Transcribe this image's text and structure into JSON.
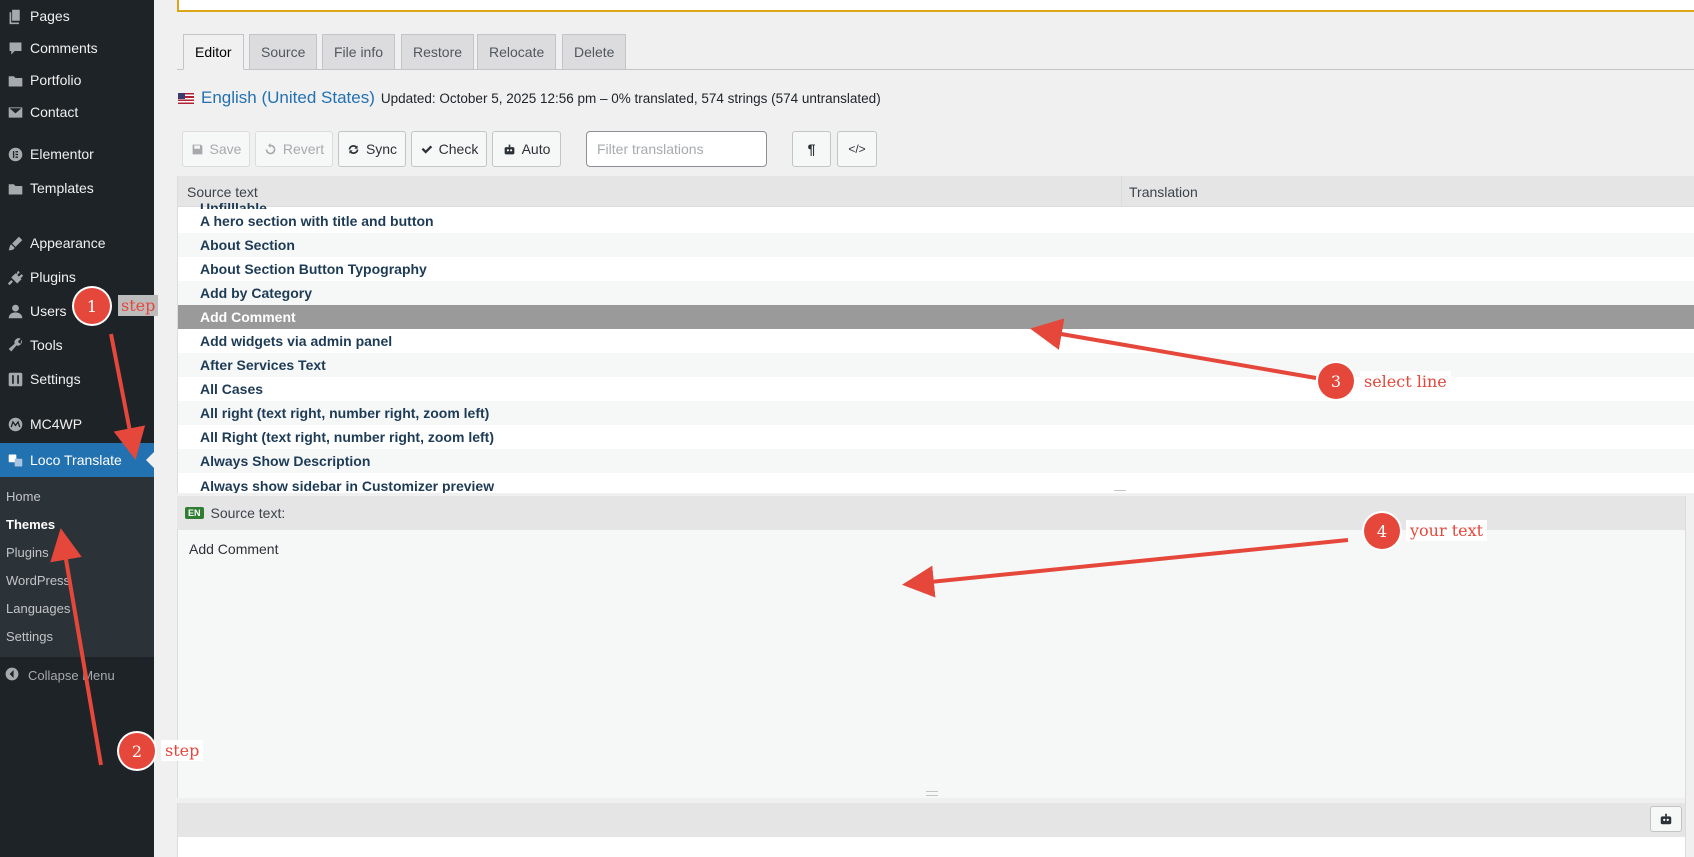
{
  "sidebar": {
    "items": [
      {
        "label": "Pages",
        "icon": "pages-icon"
      },
      {
        "label": "Comments",
        "icon": "comments-icon"
      },
      {
        "label": "Portfolio",
        "icon": "portfolio-icon"
      },
      {
        "label": "Contact",
        "icon": "mail-icon"
      },
      {
        "label": "Elementor",
        "icon": "elementor-icon"
      },
      {
        "label": "Templates",
        "icon": "folder-icon"
      },
      {
        "label": "Appearance",
        "icon": "brush-icon"
      },
      {
        "label": "Plugins",
        "icon": "plugin-icon"
      },
      {
        "label": "Users",
        "icon": "user-icon"
      },
      {
        "label": "Tools",
        "icon": "wrench-icon"
      },
      {
        "label": "Settings",
        "icon": "settings-icon"
      },
      {
        "label": "MC4WP",
        "icon": "mc4wp-icon"
      },
      {
        "label": "Loco Translate",
        "icon": "translate-icon",
        "active": true
      }
    ],
    "submenu": [
      "Home",
      "Themes",
      "Plugins",
      "WordPress",
      "Languages",
      "Settings"
    ],
    "submenu_current": "Themes",
    "collapse_label": "Collapse Menu"
  },
  "tabs": [
    "Editor",
    "Source",
    "File info",
    "Restore",
    "Relocate",
    "Delete"
  ],
  "active_tab": "Editor",
  "language": {
    "name": "English (United States)",
    "meta": "Updated: October 5, 2025 12:56 pm – 0% translated, 574 strings (574 untranslated)"
  },
  "toolbar": {
    "save": "Save",
    "revert": "Revert",
    "sync": "Sync",
    "check": "Check",
    "auto": "Auto",
    "filter_placeholder": "Filter translations",
    "pilcrow": "¶",
    "code": "</>"
  },
  "grid": {
    "columns": [
      "Source text",
      "Translation"
    ],
    "rows": [
      "Unfilllable",
      "A hero section with title and button",
      "About Section",
      "About Section Button Typography",
      "Add by Category",
      "Add Comment",
      "Add widgets via admin panel",
      "After Services Text",
      "All Cases",
      "All right (text right, number right, zoom left)",
      "All Right (text right, number right, zoom left)",
      "Always Show Description",
      "Always show sidebar in Customizer preview"
    ],
    "selected_row": "Add Comment"
  },
  "source_panel": {
    "badge": "EN",
    "label": "Source text:",
    "text": "Add Comment"
  },
  "annotations": {
    "badges": [
      "1",
      "2",
      "3",
      "4"
    ],
    "notes": [
      "step",
      "step",
      "select line",
      "your text"
    ],
    "color": "#e5473b"
  },
  "colors": {
    "sidebar_bg": "#1d2327",
    "accent": "#2271b1",
    "selected_row": "#9a9a9a",
    "annotation": "#e5473b"
  }
}
